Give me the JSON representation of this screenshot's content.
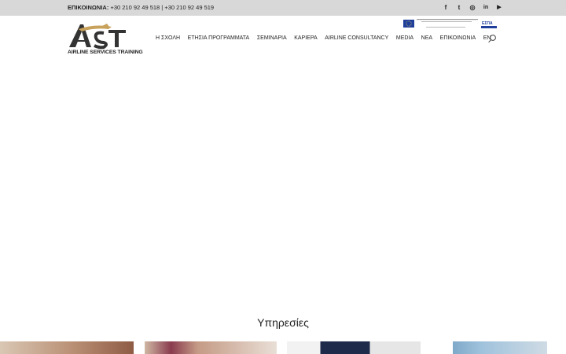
{
  "topbar": {
    "contact_label": "ΕΠΙΚΟΙΝΩΝΙΑ:",
    "phones": "+30 210 92 49 518 | +30 210 92 49 519"
  },
  "social": [
    {
      "icon": "facebook-icon",
      "glyph": "f"
    },
    {
      "icon": "twitter-icon",
      "glyph": "t"
    },
    {
      "icon": "instagram-icon",
      "glyph": "◎"
    },
    {
      "icon": "linkedin-icon",
      "glyph": "in"
    },
    {
      "icon": "youtube-icon",
      "glyph": "▶"
    }
  ],
  "logo": {
    "mark": "AST",
    "caption": "AIRLINE SERVICES TRAINING"
  },
  "badge": {
    "espa": "ΕΣΠΑ"
  },
  "nav": [
    "Η ΣΧΟΛΗ",
    "ΕΤΗΣΙΑ ΠΡΟΓΡΑΜΜΑΤΑ",
    "ΣΕΜΙΝΑΡΙΑ",
    "ΚΑΡΙΕΡΑ",
    "AIRLINE CONSULTANCY",
    "MEDIA",
    "ΝΕΑ",
    "ΕΠΙΚΟΙΝΩΝΙΑ",
    "EN"
  ],
  "section": {
    "title": "Υπηρεσίες"
  },
  "colors": {
    "topbar": "#d8d8d8",
    "text": "#222222",
    "accent": "#c8a15a"
  }
}
